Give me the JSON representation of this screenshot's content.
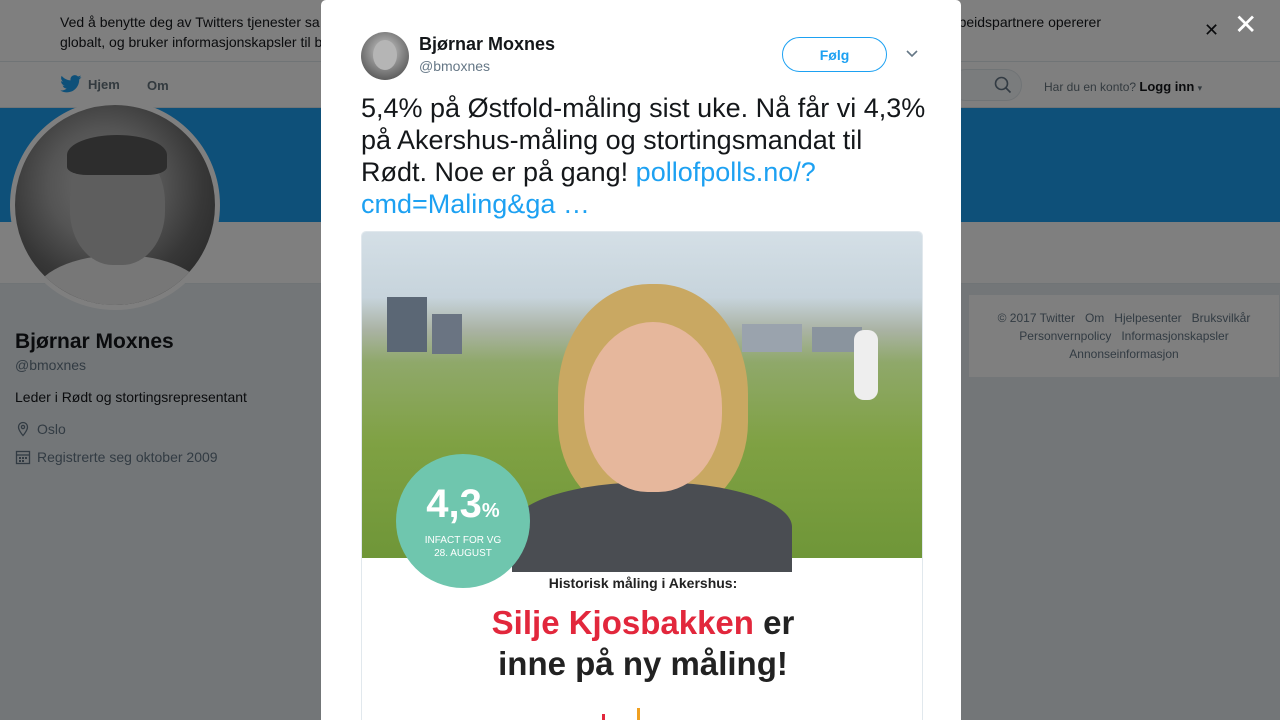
{
  "cookie": {
    "text": "Ved å benytte deg av Twitters tjenester sa                                                                                                    samarbeidspartnere opererer globalt, og bruker informasjonskapsler til b",
    "text_left": "Ved å benytte deg av Twitters tjenester sa",
    "text_right": "samarbeidspartnere opererer",
    "text_line2": "globalt, og bruker informasjonskapsler til b"
  },
  "nav": {
    "home": "Hjem",
    "about": "Om",
    "login_question": "Har du en konto?",
    "login_link": "Logg inn"
  },
  "profile": {
    "name": "Bjørnar Moxnes",
    "handle": "@bmoxnes",
    "bio": "Leder i Rødt og stortingsrepresentant",
    "location": "Oslo",
    "joined": "Registrerte seg oktober 2009"
  },
  "footer": {
    "items": [
      "© 2017 Twitter",
      "Om",
      "Hjelpesenter",
      "Bruksvilkår",
      "Personvernpolicy",
      "Informasjonskapsler",
      "Annonseinformasjon"
    ]
  },
  "tweet": {
    "author_name": "Bjørnar Moxnes",
    "author_handle": "@bmoxnes",
    "follow_label": "Følg",
    "text": "5,4% på Østfold-måling sist uke. Nå får vi 4,3% på Akershus-måling og stortingsmandat til Rødt. Noe er på gang!",
    "link": "pollofpolls.no/?cmd=Maling&ga …",
    "link_line1": "pollofpolls.no/?",
    "link_line2": "cmd=Maling&ga …"
  },
  "media": {
    "poll_value": "4,3",
    "poll_unit": "%",
    "poll_source_1": "INFACT FOR VG",
    "poll_source_2": "28. AUGUST",
    "sub_headline": "Historisk måling i Akershus:",
    "headline_name": "Silje Kjosbakken",
    "headline_er": " er",
    "headline_line2": "inne på ny måling!"
  },
  "colors": {
    "accent": "#1da1f2",
    "banner": "#1da1f2",
    "badge": "#6fc6ae",
    "headline_red": "#e2273c"
  }
}
